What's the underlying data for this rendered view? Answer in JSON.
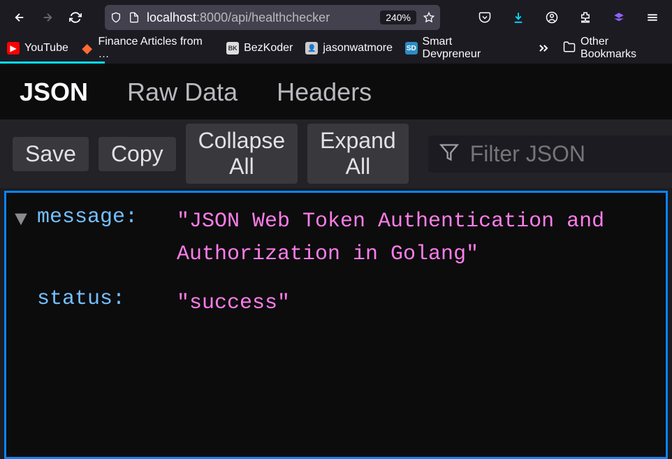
{
  "nav": {
    "back_enabled": true,
    "forward_enabled": false
  },
  "url": {
    "host": "localhost",
    "port_path": ":8000/api/healthchecker",
    "zoom": "240%"
  },
  "bookmarks": {
    "youtube": "YouTube",
    "finance": "Finance Articles from …",
    "bezkoder": "BezKoder",
    "jason": "jasonwatmore",
    "smart": "Smart Devpreneur",
    "other": "Other Bookmarks"
  },
  "viewer": {
    "tabs": {
      "json": "JSON",
      "raw": "Raw Data",
      "headers": "Headers"
    },
    "toolbar": {
      "save": "Save",
      "copy": "Copy",
      "collapse": "Collapse All",
      "expand": "Expand All",
      "filter_placeholder": "Filter JSON"
    }
  },
  "json_data": {
    "keys": {
      "message": "message:",
      "status": "status:"
    },
    "values": {
      "message": "\"JSON Web Token Authentication and Authorization in Golang\"",
      "status": "\"success\""
    }
  }
}
